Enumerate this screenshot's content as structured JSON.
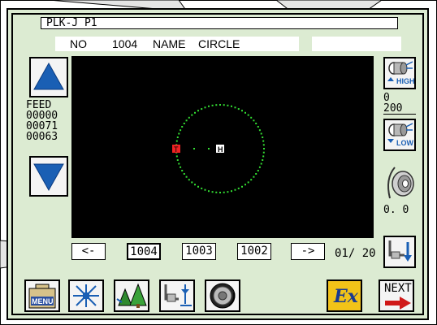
{
  "title_bar": {
    "text": "PLK-J P1"
  },
  "pattern_info": {
    "no_label": "NO",
    "no_value": "1004",
    "name_label": "NAME",
    "name_value": "CIRCLE"
  },
  "feed": {
    "label": "FEED",
    "lines": [
      "00000",
      "00071",
      "00063"
    ]
  },
  "speed": {
    "high_label": "HIGH",
    "low_label": "LOW",
    "value_top": "0",
    "value_bottom": "200"
  },
  "tension": {
    "value": "0. 0"
  },
  "page_nav": {
    "prev_label": "<-",
    "items": [
      "1004",
      "1003",
      "1002"
    ],
    "selected": "1004",
    "next_label": "->",
    "page_indicator": "01/ 20"
  },
  "toolbar": {
    "menu_label": "MENU",
    "next_label": "NEXT",
    "ex_label": "Ex"
  },
  "preview": {
    "stitch_color": "#33dd33",
    "start_marker": "T",
    "home_marker": "H",
    "start_color": "#ee2222"
  },
  "icons": [
    "up-arrow-icon",
    "down-arrow-icon",
    "thread-high-icon",
    "thread-low-icon",
    "tension-dial-icon",
    "needle-down-icon",
    "menu-icon",
    "expand-icon",
    "trees-icon",
    "needle-set-icon",
    "dial-icon",
    "ex-icon",
    "next-arrow-icon"
  ]
}
